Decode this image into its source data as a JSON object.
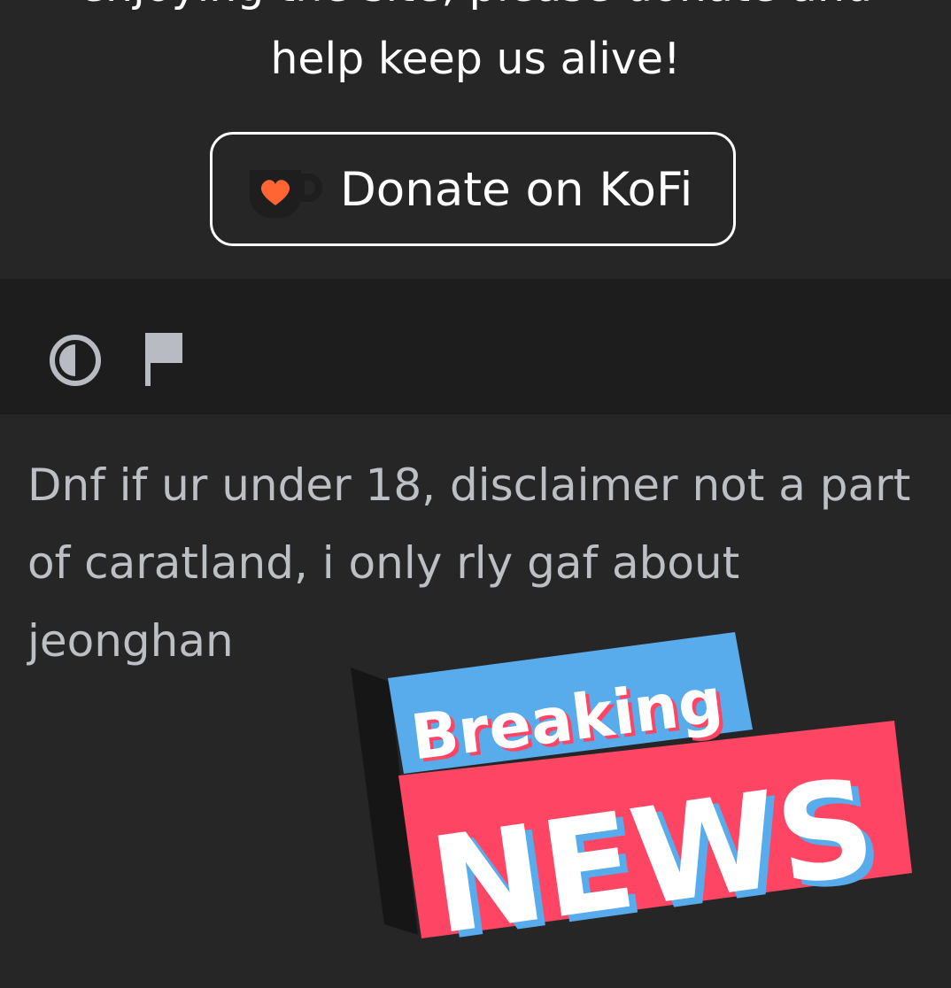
{
  "header": {
    "cut_text": "enjoying the site, please donate and",
    "message_line": "help keep us alive!"
  },
  "donate_button": {
    "label": "Donate on KoFi",
    "icon": "kofi-cup-heart-icon",
    "heart_color": "#ff6433"
  },
  "toolbar": {
    "icons": [
      "contrast-toggle-icon",
      "flag-icon"
    ],
    "icon_color": "#b8bcc2"
  },
  "bio": {
    "text": "Dnf if ur under 18, disclaimer not a part of caratland, i only rly gaf about jeonghan"
  },
  "sticker": {
    "word_top": "Breaking",
    "word_bottom": "NEWS",
    "top_bg": "#58acec",
    "bottom_bg": "#ff4564"
  }
}
